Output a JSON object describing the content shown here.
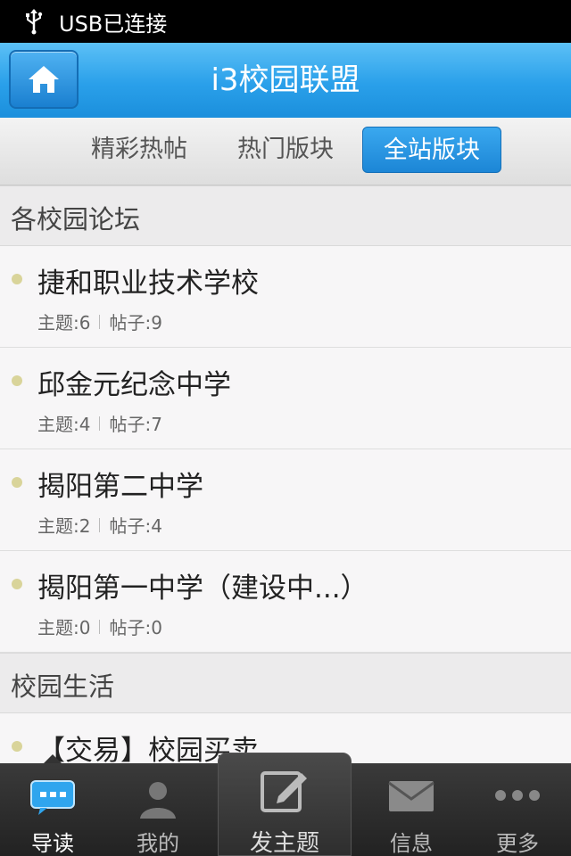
{
  "status_bar": {
    "text": "USB已连接"
  },
  "header": {
    "title": "i3校园联盟"
  },
  "tabs": [
    {
      "label": "精彩热帖"
    },
    {
      "label": "热门版块"
    },
    {
      "label": "全站版块",
      "active": true
    }
  ],
  "sections": [
    {
      "title": "各校园论坛",
      "items": [
        {
          "name": "捷和职业技术学校",
          "topics": "主题:6",
          "posts": "帖子:9"
        },
        {
          "name": "邱金元纪念中学",
          "topics": "主题:4",
          "posts": "帖子:7"
        },
        {
          "name": "揭阳第二中学",
          "topics": "主题:2",
          "posts": "帖子:4"
        },
        {
          "name": "揭阳第一中学（建设中...）",
          "topics": "主题:0",
          "posts": "帖子:0"
        }
      ]
    },
    {
      "title": "校园生活",
      "items": [
        {
          "name": "【交易】校园买卖"
        }
      ]
    }
  ],
  "bottom_nav": [
    {
      "label": "导读",
      "icon": "chat-bubble-icon",
      "active": true
    },
    {
      "label": "我的",
      "icon": "user-icon"
    },
    {
      "label": "发主题",
      "icon": "compose-icon"
    },
    {
      "label": "信息",
      "icon": "mail-icon"
    },
    {
      "label": "更多",
      "icon": "more-icon"
    }
  ],
  "colors": {
    "header_blue": "#2aa0ea",
    "active_tab": "#1c86d6",
    "bullet": "#d9d49a",
    "nav_bg": "#2a2a2a"
  }
}
